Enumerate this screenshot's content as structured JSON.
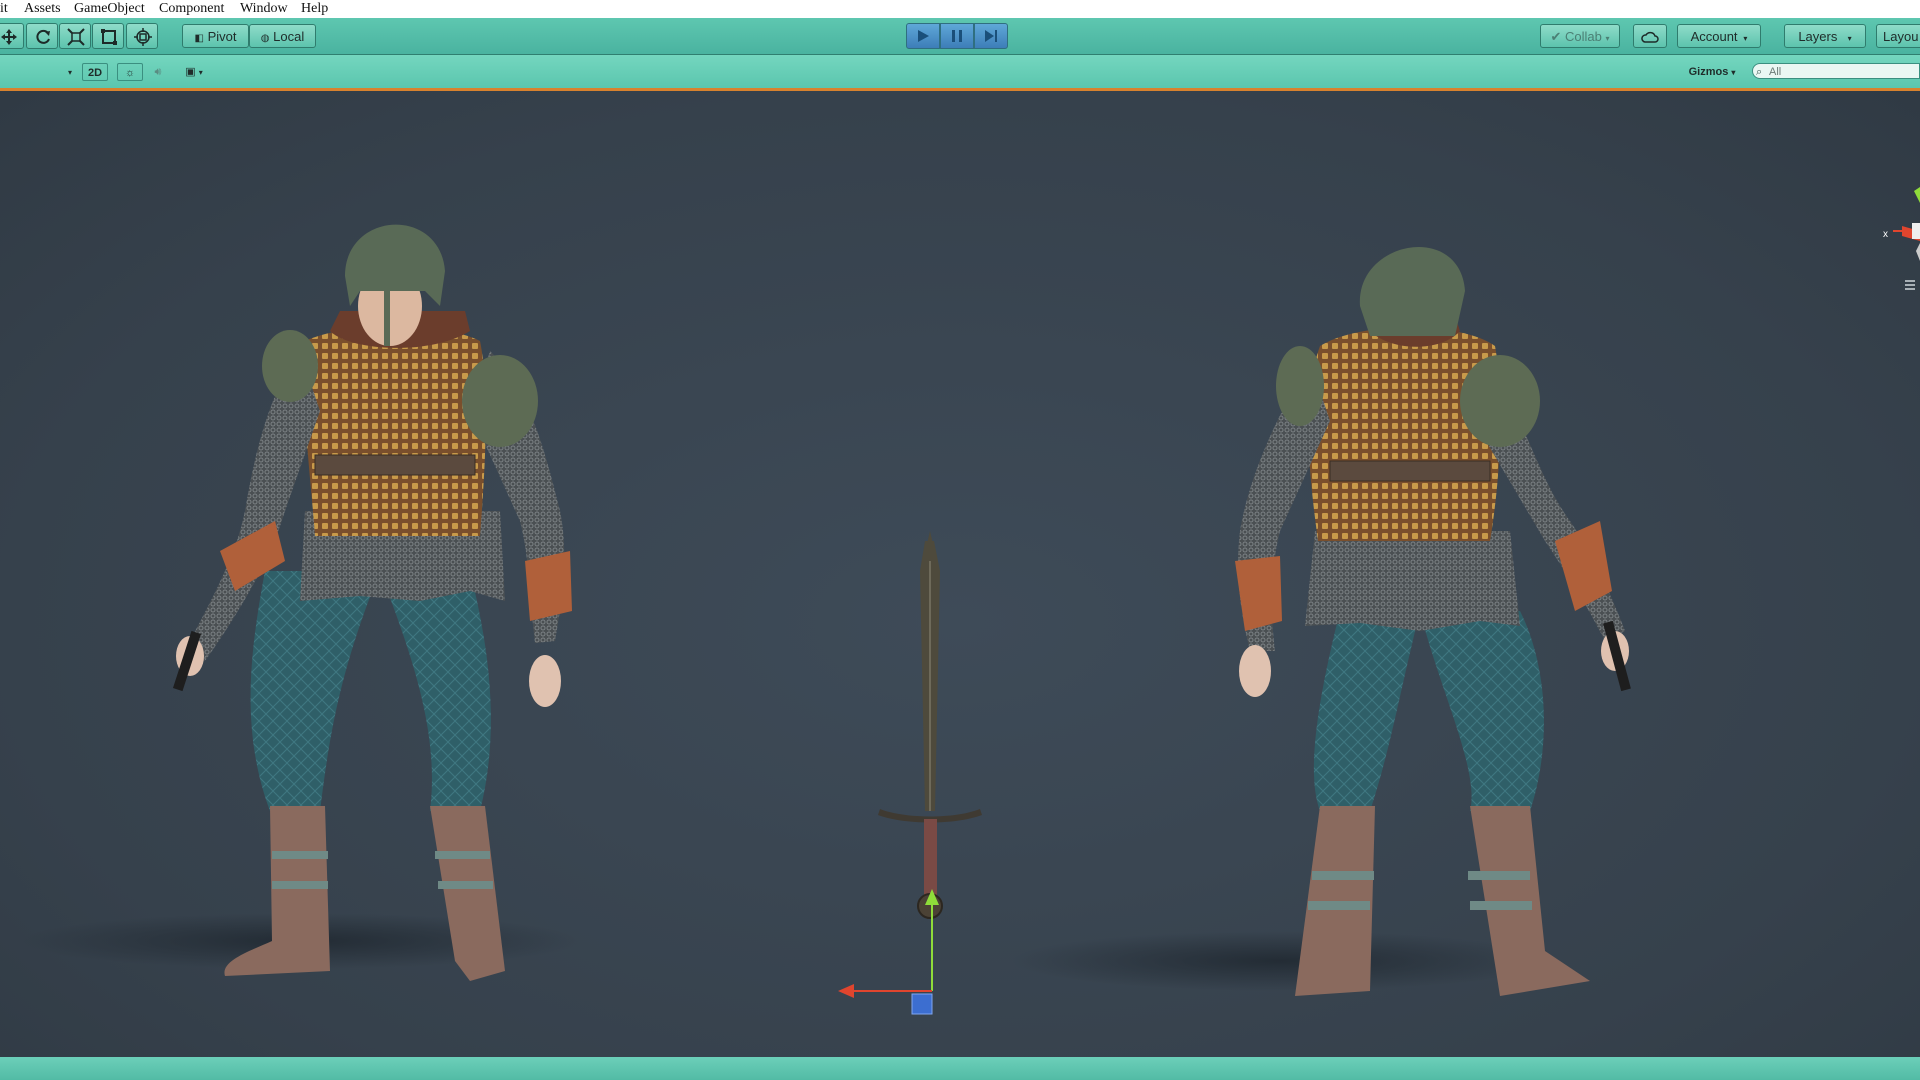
{
  "menu": {
    "items": [
      "it",
      "Assets",
      "GameObject",
      "Component",
      "Window",
      "Help"
    ]
  },
  "toolbar": {
    "tools": [
      "move-tool",
      "rotate-tool",
      "scale-tool",
      "rect-tool",
      "transform-tool"
    ],
    "pivot_label": "Pivot",
    "local_label": "Local",
    "collab_label": "Collab",
    "account_label": "Account",
    "layers_label": "Layers",
    "layout_label": "Layou"
  },
  "scene_toolbar": {
    "mode_2d": "2D",
    "gizmos_label": "Gizmos",
    "search_placeholder": "All"
  },
  "colors": {
    "toolbar_teal": "#5ec7b0",
    "play_blue": "#3d7db8",
    "viewport_bg": "#3a4550",
    "accent_orange": "#d8822e"
  }
}
